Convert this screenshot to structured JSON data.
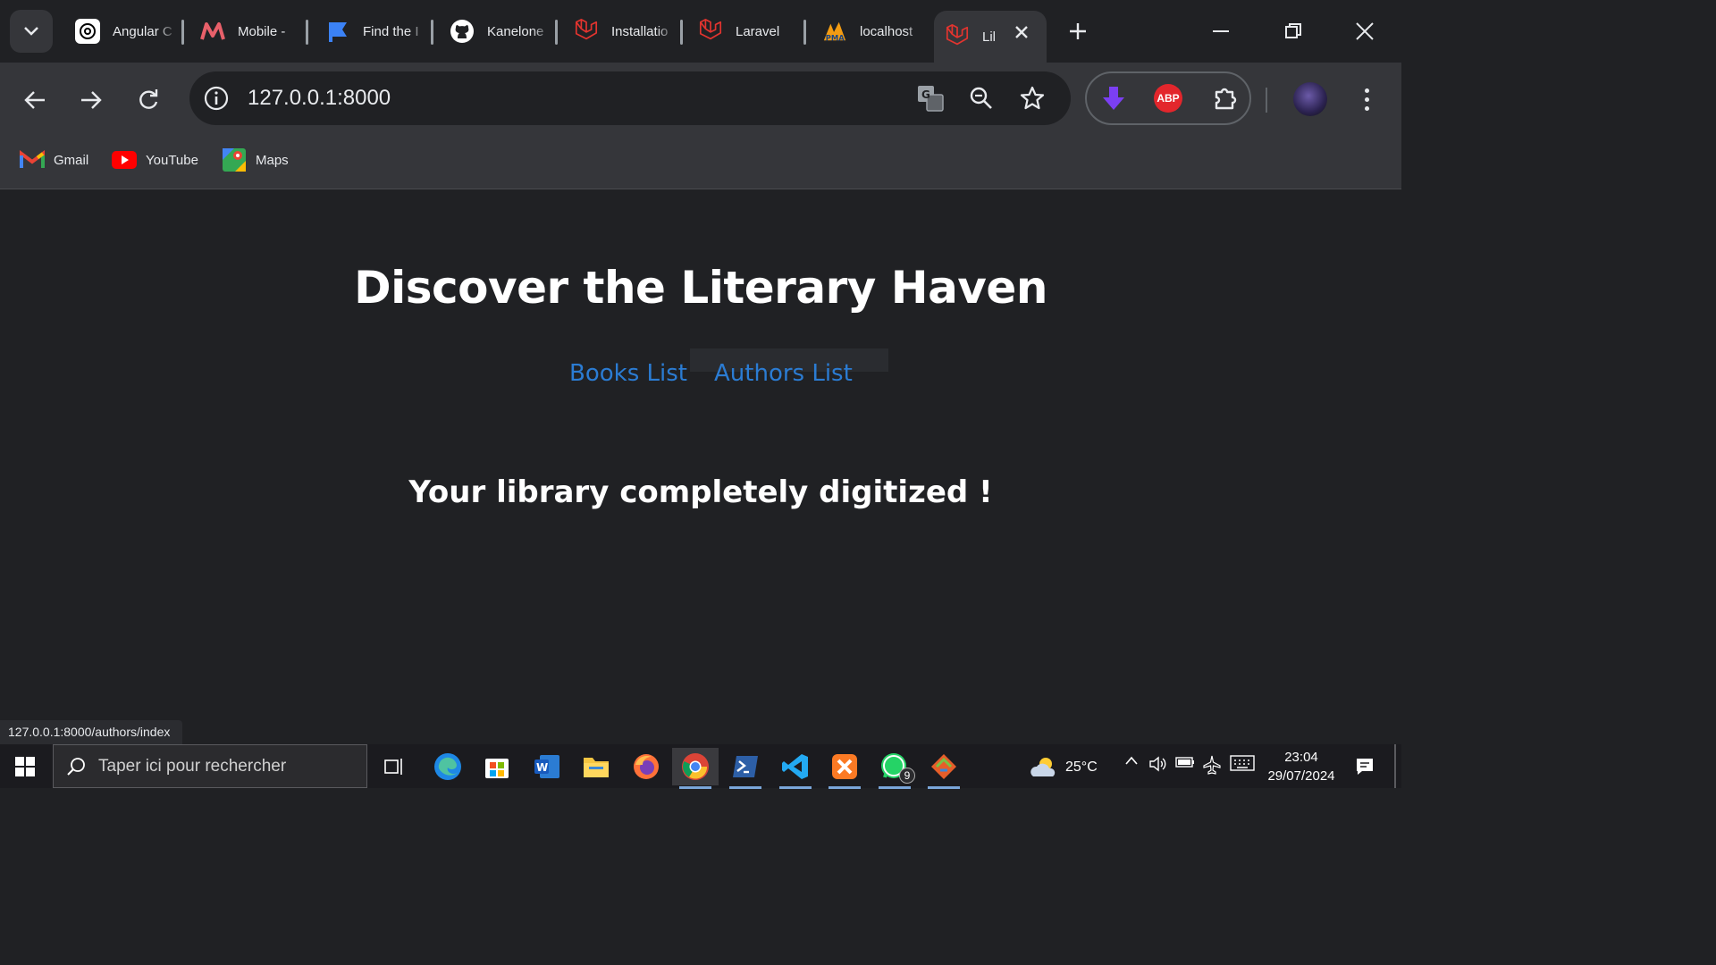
{
  "browser": {
    "tabs": [
      {
        "title": "Angular C",
        "icon": "chatgpt-icon"
      },
      {
        "title": "Mobile -",
        "icon": "mobile-m-icon"
      },
      {
        "title": "Find the I",
        "icon": "flag-icon"
      },
      {
        "title": "Kanelone",
        "icon": "github-icon"
      },
      {
        "title": "Installatio",
        "icon": "laravel-icon"
      },
      {
        "title": "Laravel",
        "icon": "laravel-icon"
      },
      {
        "title": "localhost",
        "icon": "phpmyadmin-icon"
      },
      {
        "title": "Lil",
        "icon": "laravel-icon",
        "active": true
      }
    ],
    "address": {
      "url": "127.0.0.1:8000"
    },
    "bookmarks": [
      {
        "label": "Gmail",
        "icon": "gmail-icon"
      },
      {
        "label": "YouTube",
        "icon": "youtube-icon"
      },
      {
        "label": "Maps",
        "icon": "maps-icon"
      }
    ],
    "extensions": {
      "abp_label": "ABP"
    },
    "status_url": "127.0.0.1:8000/authors/index"
  },
  "page": {
    "title": "Discover the Literary Haven",
    "nav": [
      {
        "label": "Books List"
      },
      {
        "label": "Authors List"
      }
    ],
    "tagline": "Your library completely digitized !",
    "link_color": "#2b7cd3"
  },
  "taskbar": {
    "search_placeholder": "Taper ici pour rechercher",
    "weather": "25°C",
    "time": "23:04",
    "date": "29/07/2024",
    "whatsapp_badge": "9"
  }
}
